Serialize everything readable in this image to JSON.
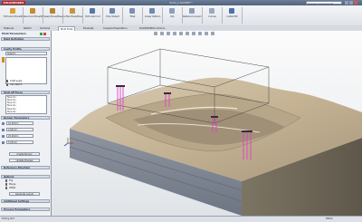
{
  "app": {
    "logo_text": "SOLIDWORKS",
    "title": "Solid_1.SLDPRT *",
    "search_placeholder": "Search Commands"
  },
  "ribbon": {
    "groups": [
      {
        "label": "Extruded Boss/Base",
        "icon": "extrude-icon",
        "color": "#d7a23a"
      },
      {
        "label": "Revolved Boss/Base",
        "icon": "revolve-icon",
        "color": "#c98b2c"
      },
      {
        "label": "Swept Boss/Base",
        "icon": "sweep-icon",
        "color": "#b98432"
      },
      {
        "label": "Lofted Boss/Base",
        "icon": "loft-icon",
        "color": "#c7943b"
      },
      {
        "label": "Extruded Cut",
        "icon": "cut-icon",
        "color": "#5677a8"
      },
      {
        "label": "Hole Wizard",
        "icon": "hole-icon",
        "color": "#6b86b3"
      },
      {
        "label": "Fillet",
        "icon": "fillet-icon",
        "color": "#7a90b8"
      },
      {
        "label": "Linear Pattern",
        "icon": "pattern-icon",
        "color": "#6f8ab5"
      },
      {
        "label": "Rib",
        "icon": "rib-icon",
        "color": "#8aa0c4"
      },
      {
        "label": "Reference Geometry",
        "icon": "plane-icon",
        "color": "#8b9dbb"
      },
      {
        "label": "Curves",
        "icon": "curve-icon",
        "color": "#9aa9c3"
      },
      {
        "label": "Instant3D",
        "icon": "instant3d-icon",
        "color": "#4a74b0"
      }
    ]
  },
  "tabs": [
    "Features",
    "Sketch",
    "Surfaces",
    "Mold Tools",
    "Evaluate",
    "Analysis Preparation",
    "SOLIDWORKS Add-Ins"
  ],
  "panel": {
    "title": "Mold Parameters",
    "sections": [
      {
        "label": "Mold Definition"
      },
      {
        "label": "Cavity Profile"
      },
      {
        "label": "Shut-off Faces"
      },
      {
        "label": "Runner Parameters"
      },
      {
        "label": "Reference Direction"
      },
      {
        "label": "Options"
      },
      {
        "label": "Additional Settings"
      },
      {
        "label": "Process Parameters"
      }
    ],
    "profile_value": "Sketch1",
    "faces_list": [
      "Face<1>",
      "Face<2>",
      "Face<3>",
      "Face<4>",
      "Face<5>",
      "Face<6>"
    ],
    "option_labels": [
      "Draft angle",
      "Use Sketch"
    ],
    "param_labels": [
      "10.00mm",
      "4.00mm",
      "25.00mm",
      "5.00mm"
    ],
    "buttons": [
      "Create Runner",
      "Update Preview",
      "Generate Layout"
    ],
    "check_labels": [
      "Flip",
      "Merge",
      "Offset"
    ]
  },
  "status": {
    "left": "Editing Part",
    "right": "MMGS"
  },
  "colors": {
    "accent": "#c81c1c",
    "marker": "#e040c8"
  }
}
